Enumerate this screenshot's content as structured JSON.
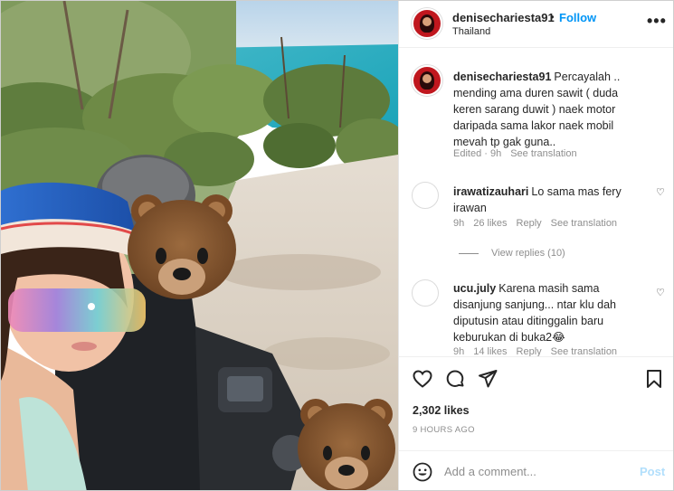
{
  "post": {
    "username": "denisechariesta91",
    "follow_label": "Follow",
    "separator": "•",
    "location": "Thailand",
    "more_icon": "more-horizontal-icon"
  },
  "caption": {
    "username": "denisechariesta91",
    "text": "Percayalah .. mending ama duren sawit ( duda keren sarang duwit ) naek motor daripada sama lakor naek mobil mevah tp gak guna..",
    "edited": "Edited · 9h",
    "see_translation": "See translation"
  },
  "comments": [
    {
      "username": "irawatizauhari",
      "text": "Lo sama mas fery irawan",
      "time": "9h",
      "likes": "26 likes",
      "reply": "Reply",
      "see_translation": "See translation",
      "view_replies": "View replies (10)"
    },
    {
      "username": "ucu.july",
      "text": "Karena masih sama disanjung sanjung... ntar klu dah diputusin atau ditinggalin baru keburukan di buka2😂",
      "time": "9h",
      "likes": "14 likes",
      "reply": "Reply",
      "see_translation": "See translation"
    }
  ],
  "actions": {
    "like_icon": "heart-icon",
    "comment_icon": "comment-icon",
    "share_icon": "send-icon",
    "save_icon": "bookmark-icon"
  },
  "likes_count": "2,302 likes",
  "timestamp": "9 HOURS AGO",
  "add_comment": {
    "placeholder": "Add a comment...",
    "post_label": "Post",
    "emoji_icon": "emoji-icon"
  },
  "colors": {
    "accent": "#0095f6",
    "post_disabled": "#b2dffc",
    "muted": "#8e8e8e"
  }
}
